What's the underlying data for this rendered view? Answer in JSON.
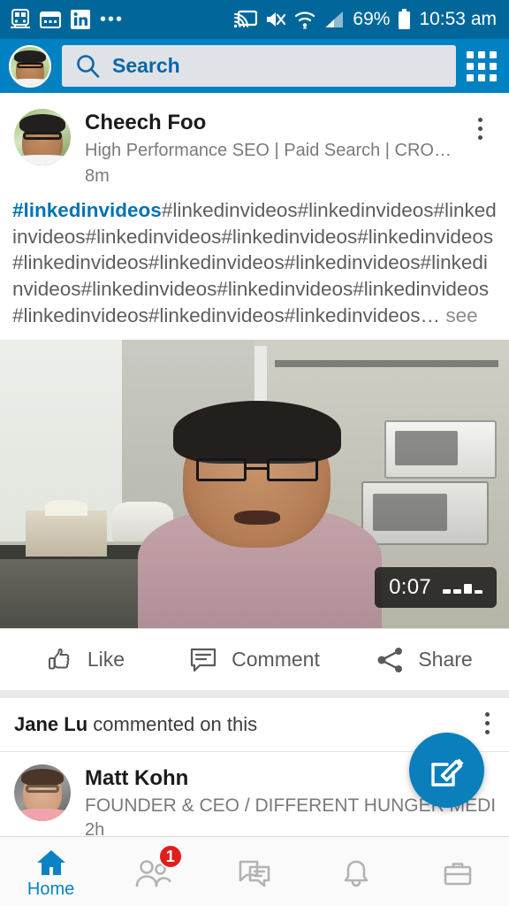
{
  "status_bar": {
    "left_icons": [
      "train-icon",
      "calendar-icon",
      "linkedin-icon",
      "more-icon"
    ],
    "right_icons": [
      "cast-icon",
      "vibrate-mute-icon",
      "wifi-icon",
      "signal-icon",
      "battery-icon"
    ],
    "battery_percent": "69%",
    "time": "10:53 am",
    "background": "#01679a"
  },
  "header": {
    "avatar_name": "me-avatar",
    "search_placeholder": "Search",
    "grid_label": "app-launcher",
    "background": "#0081c2",
    "accent": "#0073b1"
  },
  "post": {
    "author": "Cheech Foo",
    "headline": "High Performance SEO | Paid Search | CRO…",
    "age": "8m",
    "text_tag": "#linkedinvideos",
    "text_rest": "#linkedinvideos#linkedinvideos#linkedinvideos#linkedinvideos#linkedinvideos#linkedinvideos#linkedinvideos#linkedinvideos#linkedinvideos#linkedinvideos#linkedinvideos#linkedinvideos#linkedinvideos#linkedinvideos#linkedinvideos#linkedinvideos…",
    "see_more": " see",
    "video": {
      "duration": "0:07",
      "muted_icon": "volume-muted-bars-icon"
    },
    "actions": [
      {
        "label": "Like",
        "icon": "thumbs-up-icon"
      },
      {
        "label": "Comment",
        "icon": "comment-bubble-icon"
      },
      {
        "label": "Share",
        "icon": "share-nodes-icon"
      }
    ]
  },
  "second_post": {
    "social_actor": "Jane Lu",
    "social_action": " commented on this",
    "author": "Matt Kohn",
    "headline": "FOUNDER & CEO / DIFFERENT HUNGER MEDIA",
    "age": "2h"
  },
  "fab": {
    "label": "compose-post",
    "icon": "compose-pencil-icon",
    "color": "#0a7fbb"
  },
  "bottom_nav": {
    "items": [
      {
        "label": "Home",
        "icon": "home-icon",
        "active": true,
        "badge": ""
      },
      {
        "label": "My Network",
        "icon": "people-icon",
        "active": false,
        "badge": "1"
      },
      {
        "label": "Messaging",
        "icon": "messaging-icon",
        "active": false,
        "badge": ""
      },
      {
        "label": "Notifications",
        "icon": "bell-icon",
        "active": false,
        "badge": ""
      },
      {
        "label": "Jobs",
        "icon": "briefcase-icon",
        "active": false,
        "badge": ""
      }
    ],
    "active_color": "#0b82c3",
    "inactive_color": "#b3b3b3",
    "badge_color": "#e01e1e"
  }
}
